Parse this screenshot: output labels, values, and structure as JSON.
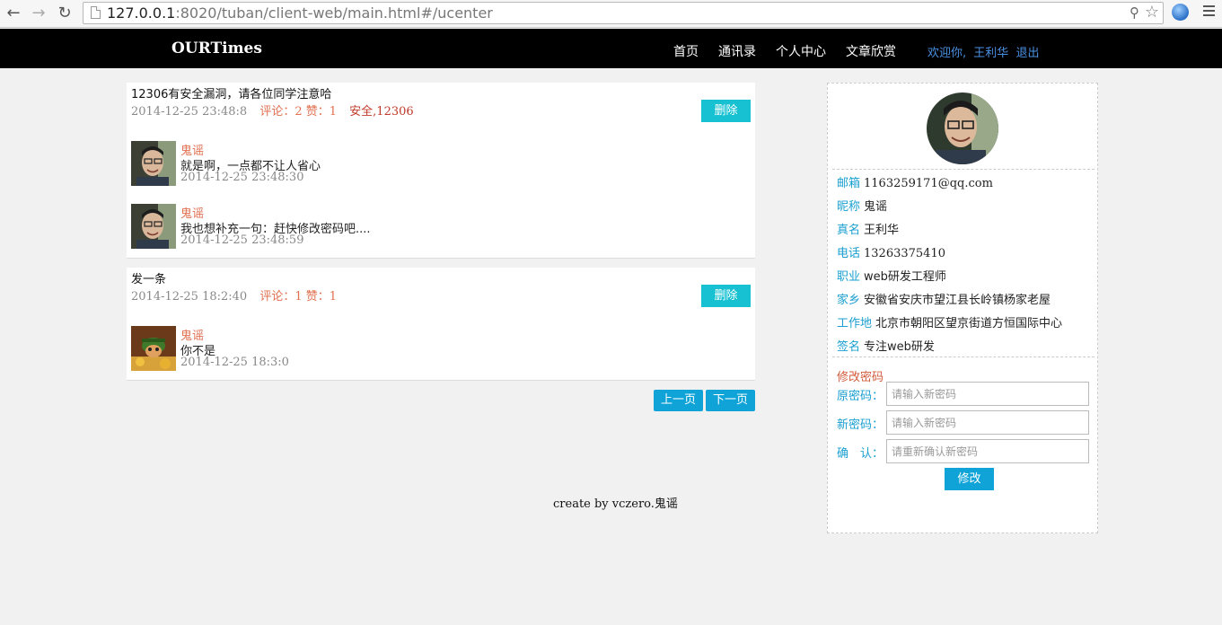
{
  "browser": {
    "url_host": "127.0.0.1",
    "url_path": ":8020/tuban/client-web/main.html#/ucenter"
  },
  "header": {
    "brand": "OURTimes",
    "nav": [
      "首页",
      "通讯录",
      "个人中心",
      "文章欣赏"
    ],
    "welcome": "欢迎你,",
    "username": "王利华",
    "logout": "退出"
  },
  "posts": [
    {
      "title": "12306有安全漏洞，请各位同学注意哈",
      "time": "2014-12-25 23:48:8",
      "counts": "评论：2 赞：1",
      "tags": "安全,12306",
      "delete_label": "删除",
      "comments": [
        {
          "author": "鬼谣",
          "text": "就是啊，一点都不让人省心",
          "time": "2014-12-25 23:48:30"
        },
        {
          "author": "鬼谣",
          "text": "我也想补充一句：赶快修改密码吧....",
          "time": "2014-12-25 23:48:59"
        }
      ]
    },
    {
      "title": "发一条",
      "time": "2014-12-25 18:2:40",
      "counts": "评论：1 赞：1",
      "tags": "",
      "delete_label": "删除",
      "comments": [
        {
          "author": "鬼谣",
          "text": "你不是",
          "time": "2014-12-25 18:3:0"
        }
      ]
    }
  ],
  "pager": {
    "prev": "上一页",
    "next": "下一页"
  },
  "footer": "create by vczero.鬼谣",
  "profile": {
    "fields": [
      {
        "key": "邮箱",
        "value": "1163259171@qq.com"
      },
      {
        "key": "昵称",
        "value": "鬼谣"
      },
      {
        "key": "真名",
        "value": "王利华"
      },
      {
        "key": "电话",
        "value": "13263375410"
      },
      {
        "key": "职业",
        "value": "web研发工程师"
      },
      {
        "key": "家乡",
        "value": "安徽省安庆市望江县长岭镇杨家老屋"
      },
      {
        "key": "工作地",
        "value": "北京市朝阳区望京街道方恒国际中心"
      },
      {
        "key": "签名",
        "value": "专注web研发"
      }
    ],
    "password": {
      "title": "修改密码",
      "old_label": "原密码：",
      "old_placeholder": "请输入新密码",
      "new_label": "新密码：",
      "new_placeholder": "请输入新密码",
      "confirm_label": "确　认：",
      "confirm_placeholder": "请重新确认新密码",
      "submit": "修改"
    }
  }
}
